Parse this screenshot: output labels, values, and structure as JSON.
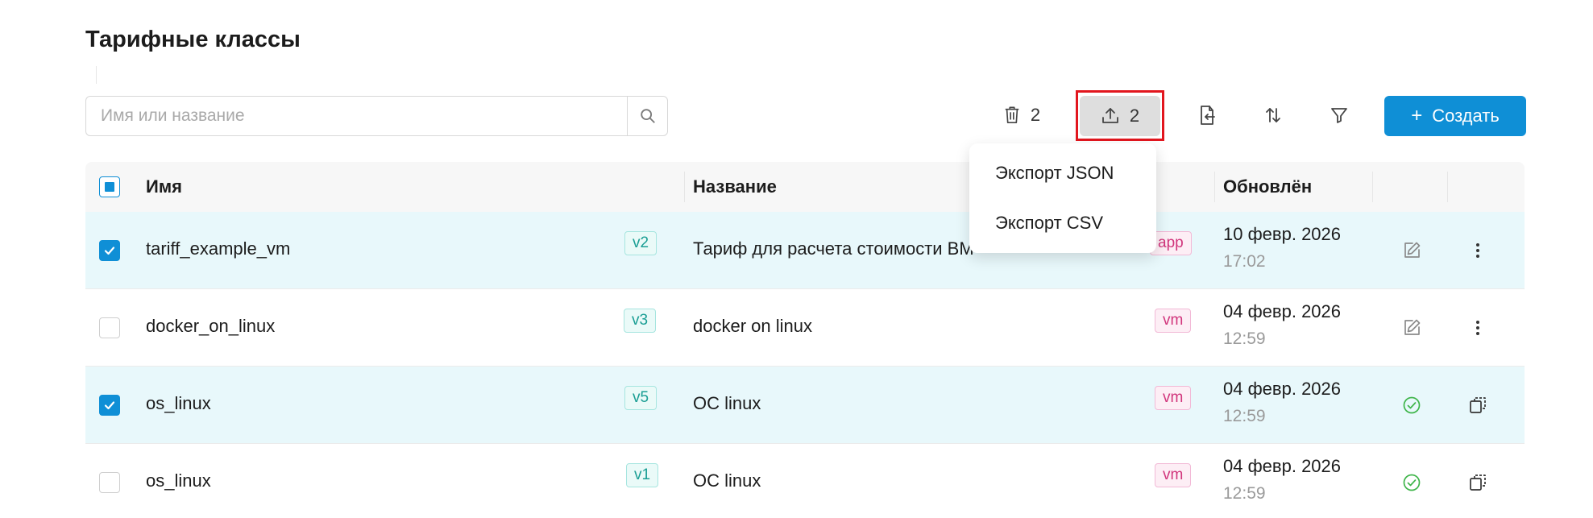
{
  "page": {
    "title": "Тарифные классы"
  },
  "search": {
    "placeholder": "Имя или название"
  },
  "toolbar": {
    "delete_count": "2",
    "export_count": "2",
    "create_label": "Создать",
    "create_plus": "+"
  },
  "export_menu": {
    "items": [
      {
        "label": "Экспорт JSON"
      },
      {
        "label": "Экспорт CSV"
      }
    ]
  },
  "table": {
    "columns": {
      "name": "Имя",
      "title": "Название",
      "updated": "Обновлён"
    },
    "rows": [
      {
        "selected": true,
        "name": "tariff_example_vm",
        "version": "v2",
        "title": "Тариф для расчета стоимости ВМ",
        "type": "app",
        "date": "10 февр. 2026",
        "time": "17:02",
        "action": "edit-icon",
        "action2": "more-icon"
      },
      {
        "selected": false,
        "name": "docker_on_linux",
        "version": "v3",
        "title": "docker on linux",
        "type": "vm",
        "date": "04 февр. 2026",
        "time": "12:59",
        "action": "edit-icon",
        "action2": "more-icon"
      },
      {
        "selected": true,
        "name": "os_linux",
        "version": "v5",
        "title": "ОС linux",
        "type": "vm",
        "date": "04 февр. 2026",
        "time": "12:59",
        "action": "check-circle-icon",
        "action2": "copy-icon"
      },
      {
        "selected": false,
        "name": "os_linux",
        "version": "v1",
        "title": "ОС linux",
        "type": "vm",
        "date": "04 февр. 2026",
        "time": "12:59",
        "action": "check-circle-icon",
        "action2": "copy-icon"
      }
    ]
  },
  "colors": {
    "accent": "#0f8fd6",
    "selected_row": "#e8f8fb",
    "highlight": "#e2161e",
    "version_text": "#1a9e94",
    "type_text": "#d1357c",
    "success": "#3fb54a"
  }
}
